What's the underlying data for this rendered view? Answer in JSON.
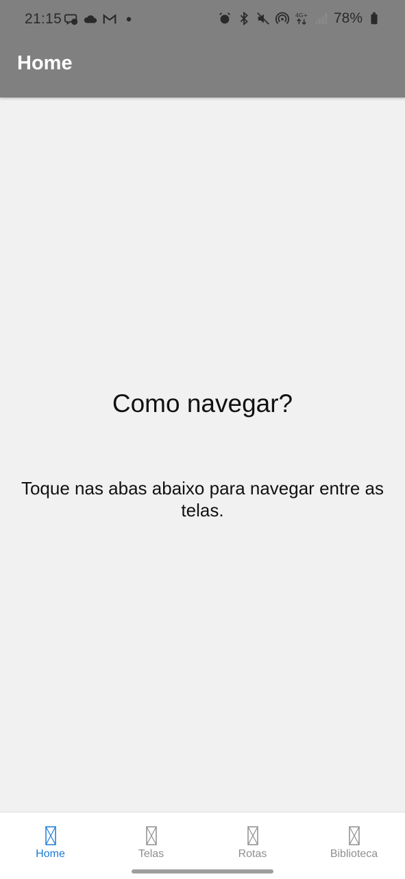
{
  "status_bar": {
    "time": "21:15",
    "battery": "78%",
    "left_icons": [
      "messenger-icon",
      "cloud-icon",
      "gmail-icon",
      "dot-icon"
    ],
    "right_icons": [
      "alarm-icon",
      "bluetooth-icon",
      "mute-icon",
      "hotspot-icon",
      "network-4g-icon",
      "signal-icon",
      "battery-icon"
    ]
  },
  "header": {
    "title": "Home"
  },
  "main": {
    "heading": "Como navegar?",
    "body": "Toque nas abas abaixo para navegar entre as telas."
  },
  "tabs": [
    {
      "label": "Home",
      "icon": "placeholder-icon",
      "active": true
    },
    {
      "label": "Telas",
      "icon": "placeholder-icon",
      "active": false
    },
    {
      "label": "Rotas",
      "icon": "placeholder-icon",
      "active": false
    },
    {
      "label": "Biblioteca",
      "icon": "placeholder-icon",
      "active": false
    }
  ],
  "colors": {
    "header_bg": "#808080",
    "screen_bg": "#f1f1f1",
    "tab_active": "#1a7bd6",
    "tab_inactive": "#8e8e8e"
  }
}
